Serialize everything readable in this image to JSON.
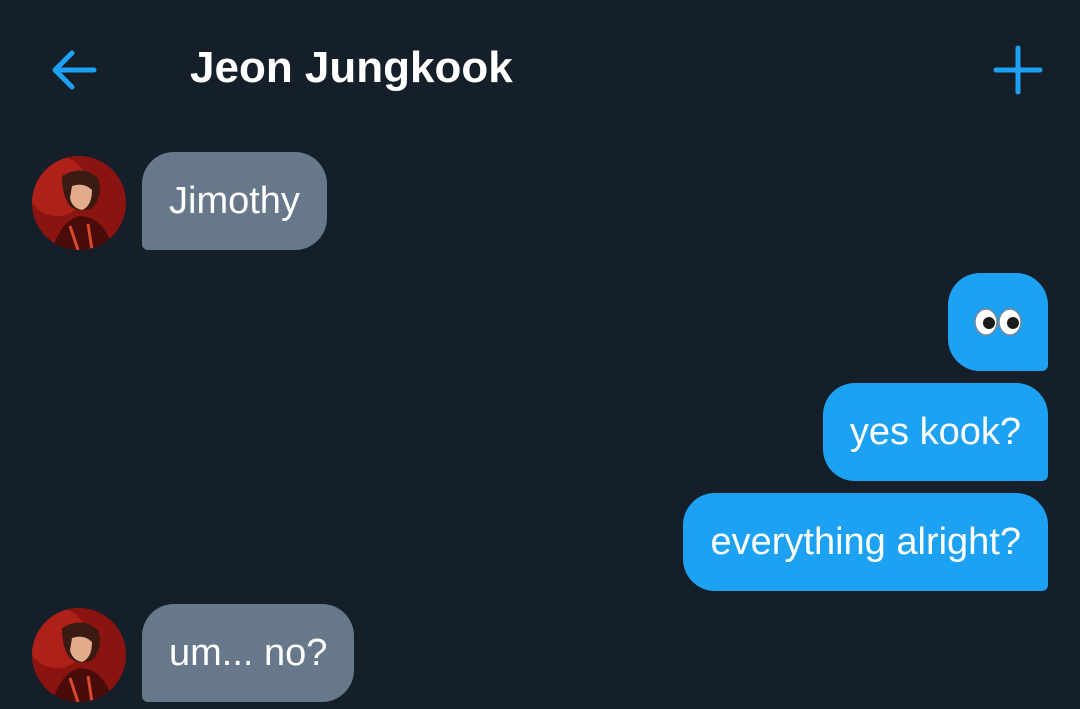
{
  "header": {
    "title": "Jeon Jungkook",
    "back_icon": "arrow-left-icon",
    "add_icon": "plus-icon",
    "accent_color": "#1da1f2"
  },
  "messages": [
    {
      "sender": "them",
      "text": "Jimothy"
    },
    {
      "sender": "me",
      "text": "👀"
    },
    {
      "sender": "me",
      "text": "yes kook?"
    },
    {
      "sender": "me",
      "text": "everything alright?"
    },
    {
      "sender": "them",
      "text": "um... no?"
    }
  ],
  "colors": {
    "background": "#151f2a",
    "received_bubble": "#66788a",
    "sent_bubble": "#1da1f2"
  }
}
